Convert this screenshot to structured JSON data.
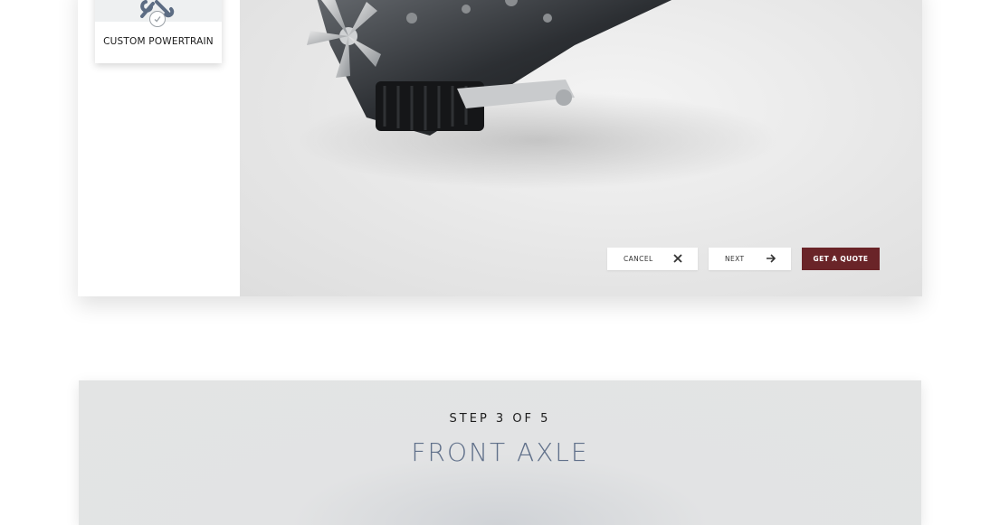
{
  "option": {
    "label": "CUSTOM POWERTRAIN",
    "icon": "wrench-icon",
    "selected": true
  },
  "buttons": {
    "cancel": "CANCEL",
    "next": "NEXT",
    "quote": "GET A QUOTE"
  },
  "step": {
    "label": "STEP 3 OF 5",
    "title": "FRONT AXLE"
  },
  "colors": {
    "quote_button": "#6a2428",
    "title": "#60708a"
  }
}
